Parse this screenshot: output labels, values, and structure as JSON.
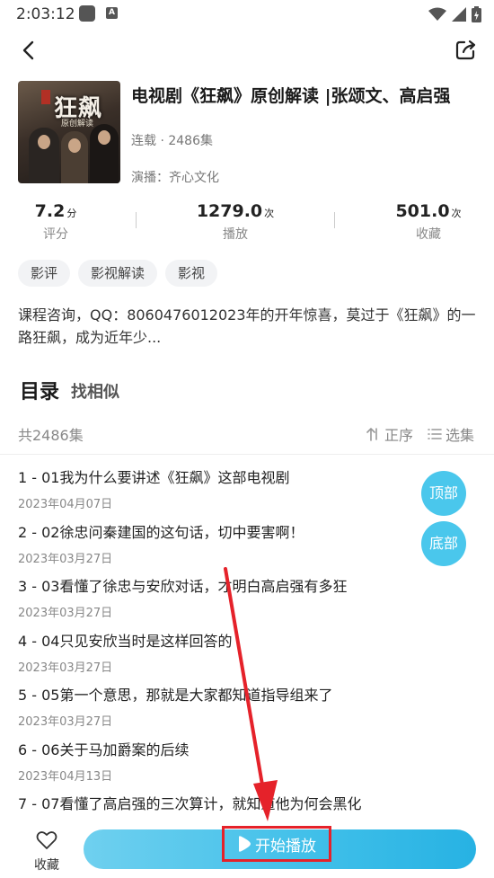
{
  "status_bar": {
    "time": "2:03:12"
  },
  "header": {
    "title": "电视剧《狂飙》原创解读 |张颂文、高启强",
    "status": "连载 · 2486集",
    "cast": "演播：齐心文化",
    "cover": {
      "title": "狂飙",
      "subtitle": "原创解读"
    }
  },
  "stats": [
    {
      "value": "7.2",
      "unit": "分",
      "label": "评分"
    },
    {
      "value": "1279.0",
      "unit": "次",
      "label": "播放"
    },
    {
      "value": "501.0",
      "unit": "次",
      "label": "收藏"
    }
  ],
  "tags": [
    "影评",
    "影视解读",
    "影视"
  ],
  "description": "课程咨询，QQ：8060476012023年的开年惊喜，莫过于《狂飙》的一路狂飙，成为近年少...",
  "toc": {
    "title": "目录",
    "similar": "找相似",
    "count": "共2486集",
    "sort_label": "正序",
    "select_label": "选集"
  },
  "episodes": [
    {
      "title": "1 - 01我为什么要讲述《狂飙》这部电视剧",
      "date": "2023年04月07日"
    },
    {
      "title": "2 - 02徐忠问秦建国的这句话，切中要害啊！",
      "date": "2023年03月27日"
    },
    {
      "title": "3 - 03看懂了徐忠与安欣对话，才明白高启强有多狂",
      "date": "2023年03月27日"
    },
    {
      "title": "4 - 04只见安欣当时是这样回答的",
      "date": "2023年03月27日"
    },
    {
      "title": "5 - 05第一个意思，那就是大家都知道指导组来了",
      "date": "2023年03月27日"
    },
    {
      "title": "6 - 06关于马加爵案的后续",
      "date": "2023年04月13日"
    },
    {
      "title": "7 - 07看懂了高启强的三次算计，就知道他为何会黑化",
      "date": ""
    }
  ],
  "float_buttons": {
    "top": "顶部",
    "bottom": "底部"
  },
  "bottom": {
    "favorite_label": "收藏",
    "play_label": "开始播放"
  },
  "colors": {
    "accent": "#4ac7ec",
    "play_gradient_end": "#27b2e3",
    "annotation_red": "#e5222a"
  }
}
